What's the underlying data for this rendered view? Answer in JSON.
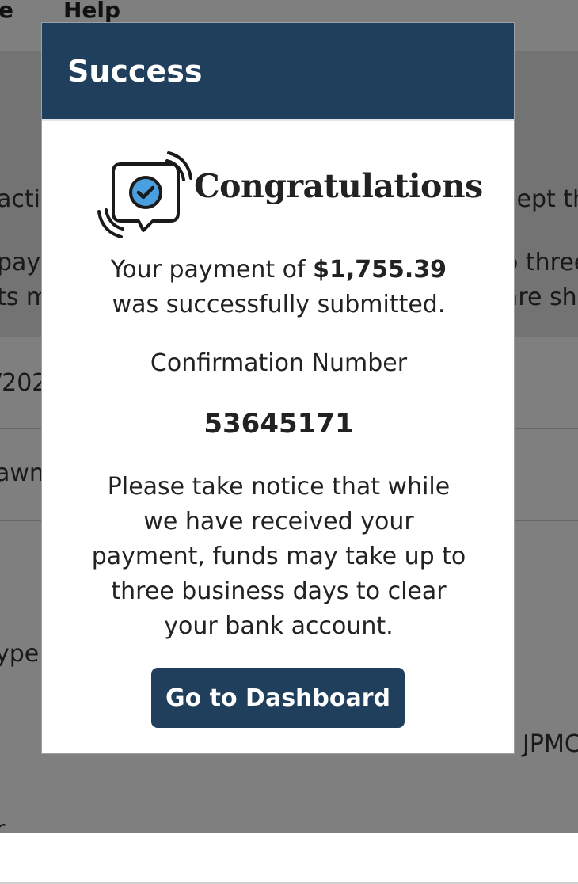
{
  "background": {
    "nav": {
      "item_left": "e",
      "item_help": "Help"
    },
    "fragments": {
      "left_1": "actio",
      "left_2": "pay",
      "left_3": "ts m",
      "right_1": "cept th",
      "right_2": "o three",
      "right_3": "are sh",
      "row_1": "/202",
      "row_2": "awn",
      "row_4": "ype",
      "row_5_right": "JPMC",
      "row_6": "r"
    }
  },
  "modal": {
    "title": "Success",
    "congrats": "Congratulations",
    "payment_prefix": "Your payment of ",
    "payment_amount": "$1,755.39",
    "payment_suffix": "was successfully submitted.",
    "confirmation_label": "Confirmation Number",
    "confirmation_number": "53645171",
    "notice_lines": [
      "Please take notice that while",
      "we have received your",
      "payment, funds may take up to",
      "three business days to clear",
      "your bank account."
    ],
    "button_label": "Go to Dashboard"
  },
  "colors": {
    "header_bg": "#1f3f5c",
    "button_bg": "#1f3f5c",
    "check_blue": "#4a9fe0"
  },
  "icons": {
    "badge": "message-check-signal-icon"
  }
}
